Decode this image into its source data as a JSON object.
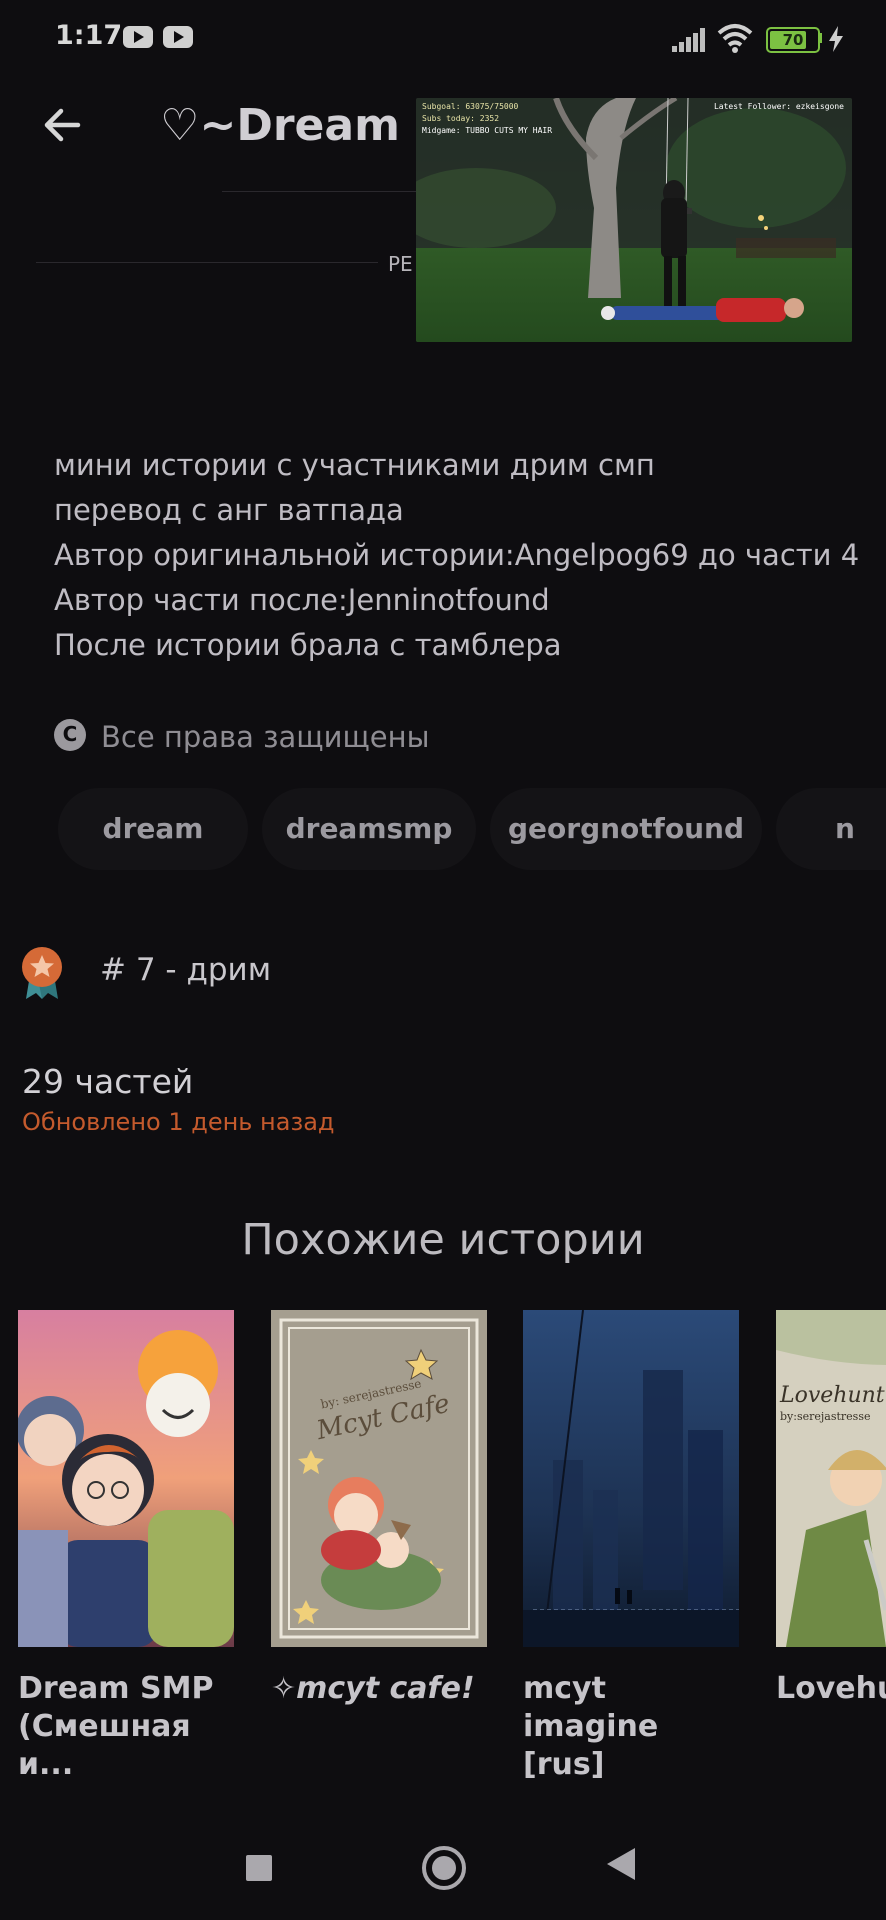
{
  "status_bar": {
    "time": "1:17",
    "battery_level": "70",
    "icons": [
      "youtube-icon",
      "youtube-icon",
      "signal-icon",
      "wifi-icon",
      "battery-icon",
      "charging-icon"
    ]
  },
  "header": {
    "title": "♡~Dream smp",
    "reading_label": "РЕ"
  },
  "video_overlay": {
    "line1": "Subgoal: 63075/75000",
    "line2": "Subs today: 2352",
    "line3": "Midgame: TUBBO CUTS MY HAIR",
    "latest": "Latest Follower: ezkeisgone"
  },
  "description": {
    "lines": [
      "мини истории с участниками дрим смп",
      "перевод с анг ватпада",
      "Автор оригинальной истории:Angelpog69 до части 4",
      "Автор части после:Jenninotfound",
      "После истории брала с тамблера"
    ]
  },
  "copyright": "Все права защищены",
  "tags": [
    "dream",
    "dreamsmp",
    "georgnotfound",
    "n"
  ],
  "ranking": "# 7 - дрим",
  "parts": {
    "count": "29 частей",
    "updated": "Обновлено 1 день назад"
  },
  "similar": {
    "heading": "Похожие истории",
    "cards": [
      {
        "title": "Dream SMP\n(Смешная и..."
      },
      {
        "title": "✧mcyt cafe!",
        "cover_text": "by: serejastresse\nMcyt Cafe"
      },
      {
        "title": "mcyt imagine\n[rus]"
      },
      {
        "title": "Lovehur",
        "cover_text": "Lovehunt\nby:serejastresse"
      }
    ]
  },
  "colors": {
    "background": "#0e0d10",
    "accent": "#c45a2d",
    "battery": "#7cc142"
  }
}
